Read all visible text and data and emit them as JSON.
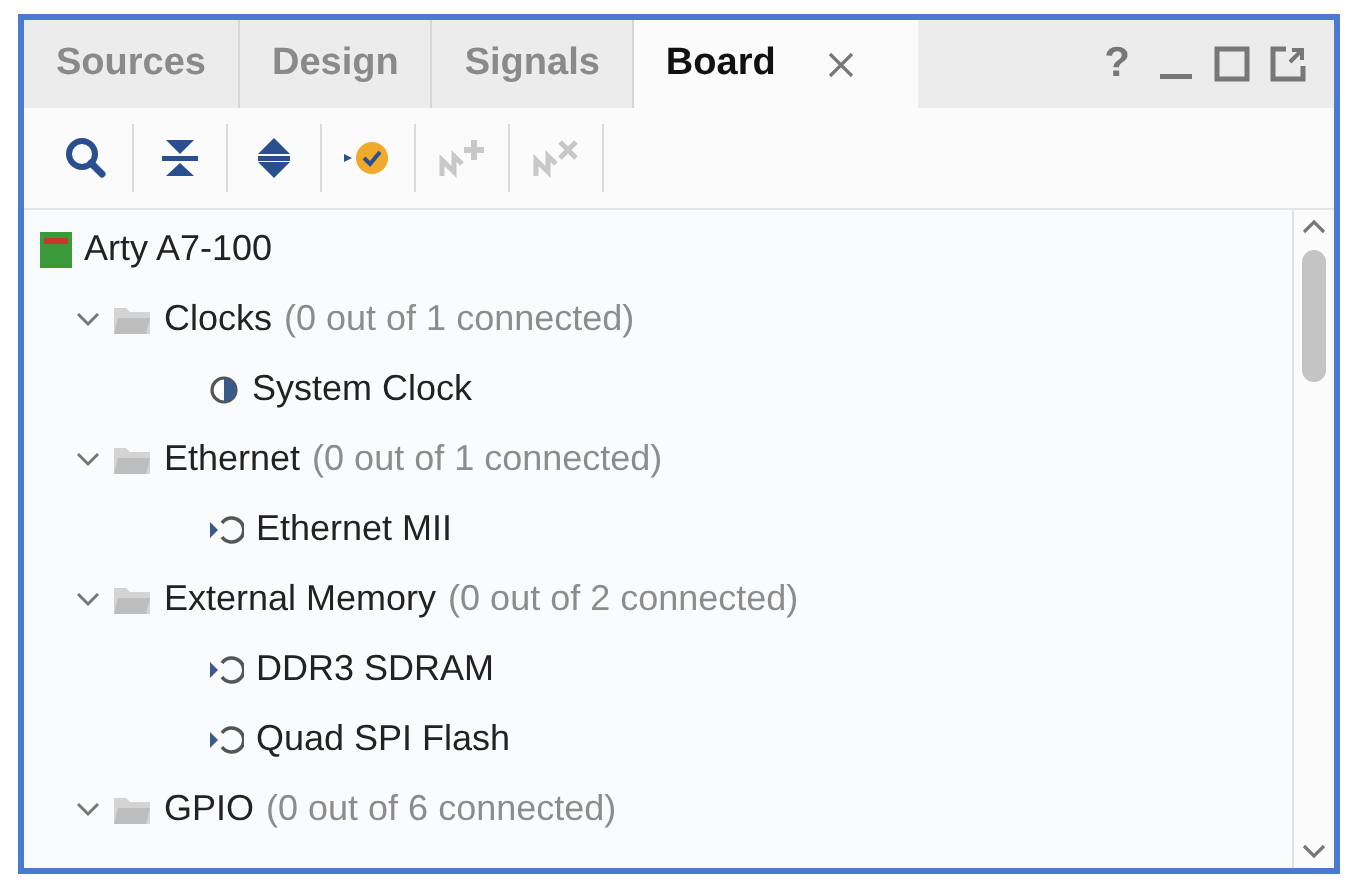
{
  "tabs": [
    {
      "label": "Sources",
      "selected": false
    },
    {
      "label": "Design",
      "selected": false
    },
    {
      "label": "Signals",
      "selected": false
    },
    {
      "label": "Board",
      "selected": true
    }
  ],
  "help_label": "?",
  "toolbar": [
    {
      "kind": "search",
      "disabled": false
    },
    {
      "kind": "collapse",
      "disabled": false
    },
    {
      "kind": "expand",
      "disabled": false
    },
    {
      "kind": "autoconnect",
      "disabled": false
    },
    {
      "kind": "connect",
      "disabled": true
    },
    {
      "kind": "disconnect",
      "disabled": true
    }
  ],
  "tree": {
    "label": "Arty A7-100",
    "children": [
      {
        "label": "Clocks",
        "note": "(0 out of 1 connected)",
        "expanded": true,
        "children": [
          {
            "label": "System Clock",
            "kind": "clock"
          }
        ]
      },
      {
        "label": "Ethernet",
        "note": "(0 out of 1 connected)",
        "expanded": true,
        "children": [
          {
            "label": "Ethernet MII",
            "kind": "interface"
          }
        ]
      },
      {
        "label": "External Memory",
        "note": "(0 out of 2 connected)",
        "expanded": true,
        "children": [
          {
            "label": "DDR3 SDRAM",
            "kind": "interface"
          },
          {
            "label": "Quad SPI Flash",
            "kind": "interface"
          }
        ]
      },
      {
        "label": "GPIO",
        "note": "(0 out of 6 connected)",
        "expanded": true
      }
    ]
  }
}
